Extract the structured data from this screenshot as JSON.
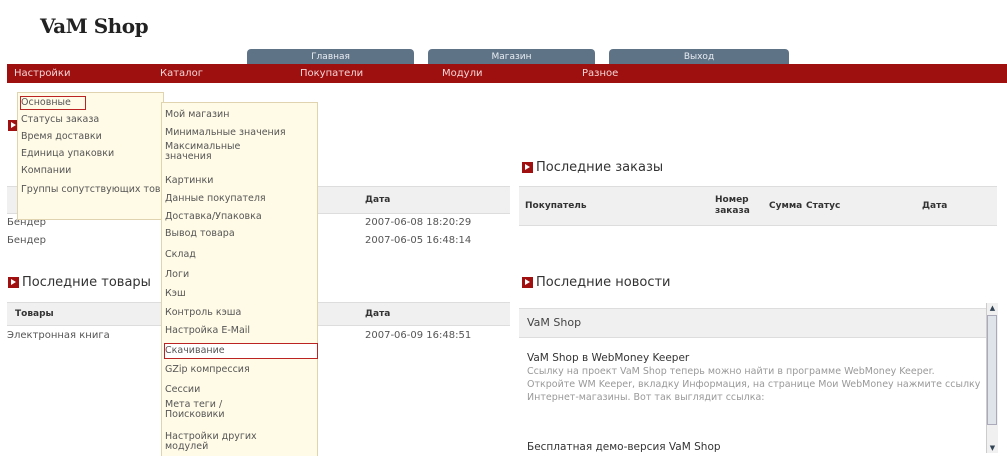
{
  "logo": "VaM Shop",
  "top_tabs": [
    "Главная",
    "Магазин",
    "Выход"
  ],
  "menu": [
    "Настройки",
    "Каталог",
    "Покупатели",
    "Модули",
    "Разное"
  ],
  "dropdown_settings": [
    "Основные",
    "Статусы заказа",
    "Время доставки",
    "Единица упаковки",
    "Компании",
    "Группы сопутствующих товаров"
  ],
  "dropdown_shop": [
    "Мой магазин",
    "Минимальные значения",
    "Максимальные значения",
    "Картинки",
    "Данные покупателя",
    "Доставка/Упаковка",
    "Вывод товара",
    "Склад",
    "Логи",
    "Кэш",
    "Контроль кэша",
    "Настройка E-Mail",
    "Скачивание",
    "GZip компрессия",
    "Сессии",
    "Мета теги / Поисковики",
    "Настройки других модулей"
  ],
  "left_table1": {
    "date_header": "Дата",
    "rows": [
      {
        "name": "Бендер",
        "date": "2007-06-08 18:20:29"
      },
      {
        "name": "Бендер",
        "date": "2007-06-05 16:48:14"
      }
    ]
  },
  "last_products": {
    "title": "Последние товары",
    "headers": [
      "Товары",
      "Дата"
    ],
    "rows": [
      {
        "name": "Электронная книга",
        "date": "2007-06-09 16:48:51"
      }
    ]
  },
  "last_orders": {
    "title": "Последние заказы",
    "headers": [
      "Покупатель",
      "Номер заказа",
      "Сумма",
      "Статус",
      "Дата"
    ]
  },
  "last_news": {
    "title": "Последние новости",
    "header": "VaM Shop",
    "item_title": "VaM Shop в WebMoney Keeper",
    "item_body": "Ссылку на проект VaM Shop теперь можно найти в программе WebMoney Keeper. Откройте WM Keeper, вкладку Информация, на странице Мои WebMoney нажмите ссылку Интернет-магазины. Вот так выглядит ссылка:",
    "next_item_title": "Бесплатная демо-версия VaM Shop"
  },
  "colors": {
    "menu_bg": "#9e1010",
    "tab_bg": "#5f7387",
    "dropdown_bg": "#fffbe7"
  }
}
